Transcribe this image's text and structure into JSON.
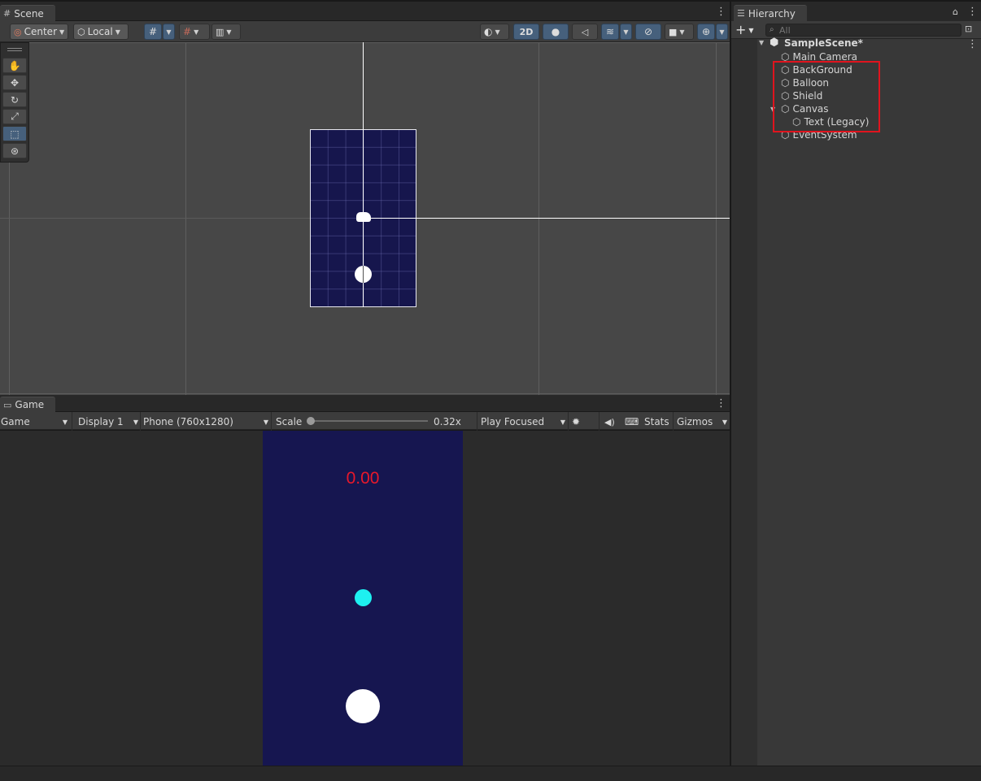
{
  "scene": {
    "tab_label": "Scene",
    "pivot_mode": "Center",
    "pivot_rotation": "Local",
    "mode_2d": "2D"
  },
  "game": {
    "tab_label": "Game",
    "view_select": "Game",
    "display": "Display 1",
    "resolution": "Phone (760x1280)",
    "scale_label": "Scale",
    "scale_value": "0.32x",
    "play_mode": "Play Focused",
    "stats": "Stats",
    "gizmos": "Gizmos",
    "timer_text": "0.00"
  },
  "hierarchy": {
    "tab_label": "Hierarchy",
    "search_placeholder": "All",
    "scene_name": "SampleScene*",
    "items": [
      {
        "label": "Main Camera"
      },
      {
        "label": "BackGround"
      },
      {
        "label": "Balloon"
      },
      {
        "label": "Shield"
      },
      {
        "label": "Canvas"
      },
      {
        "label": "Text (Legacy)"
      },
      {
        "label": "EventSystem"
      }
    ]
  },
  "colors": {
    "game_background": "#161650",
    "timer_text": "#e8182a",
    "shield": "#1ef0f0",
    "balloon": "#ffffff",
    "highlight_box": "#e0141e",
    "active_button": "#46607c"
  }
}
